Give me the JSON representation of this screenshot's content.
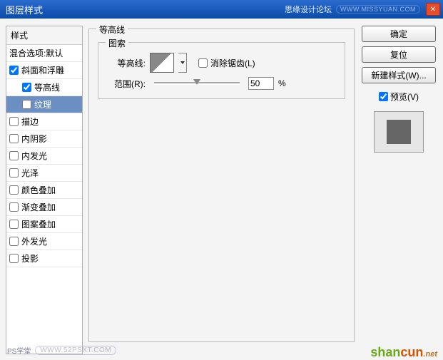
{
  "title": "图层样式",
  "titlebar_right": "思缘设计论坛",
  "titlebar_url": "WWW.MISSYUAN.COM",
  "style_header": "样式",
  "blend_options": "混合选项:默认",
  "styles": [
    {
      "label": "斜面和浮雕",
      "checked": true
    },
    {
      "label": "等高线",
      "checked": true,
      "sub": true,
      "selected": false
    },
    {
      "label": "纹理",
      "checked": false,
      "sub": true,
      "selected": true
    },
    {
      "label": "描边",
      "checked": false
    },
    {
      "label": "内阴影",
      "checked": false
    },
    {
      "label": "内发光",
      "checked": false
    },
    {
      "label": "光泽",
      "checked": false
    },
    {
      "label": "颜色叠加",
      "checked": false
    },
    {
      "label": "渐变叠加",
      "checked": false
    },
    {
      "label": "图案叠加",
      "checked": false
    },
    {
      "label": "外发光",
      "checked": false
    },
    {
      "label": "投影",
      "checked": false
    }
  ],
  "panel": {
    "legend": "等高线",
    "inner_legend": "图索",
    "contour_label": "等高线:",
    "antialias_label": "消除锯齿(L)",
    "range_label": "范围(R):",
    "range_value": "50",
    "range_unit": "%"
  },
  "buttons": {
    "ok": "确定",
    "reset": "复位",
    "new_style": "新建样式(W)..."
  },
  "preview_label": "预览(V)",
  "watermarks": {
    "bl_text": "PS学堂",
    "bl_url": "WWW.52PSXT.COM",
    "br_green": "shan",
    "br_orange": "cun",
    "br_net": ".net"
  }
}
